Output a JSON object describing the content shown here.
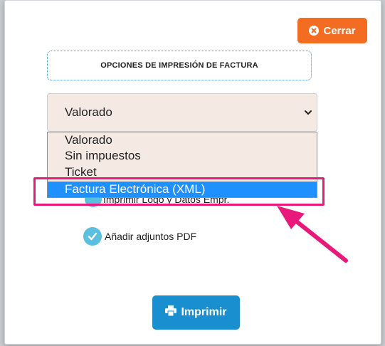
{
  "header": {
    "close_label": "Cerrar",
    "close_icon": "times-circle-icon"
  },
  "section_title": "OPCIONES DE IMPRESIÓN DE FACTURA",
  "format_select": {
    "selected": "Valorado",
    "options": [
      "Valorado",
      "Sin impuestos",
      "Ticket",
      "Factura Electrónica (XML)"
    ],
    "highlighted_index": 3
  },
  "checkboxes": {
    "hidden_label": "Imprimir Logo y Datos Empr.",
    "attachments_label": "Añadir adjuntos PDF"
  },
  "footer": {
    "print_label": "Imprimir",
    "print_icon": "printer-icon"
  },
  "colors": {
    "close_button": "#f36c21",
    "print_button": "#1a8fd0",
    "select_bg": "#f4e9e3",
    "option_selected": "#1e90ff",
    "annotation": "#e8197a",
    "check": "#5bc0de"
  }
}
